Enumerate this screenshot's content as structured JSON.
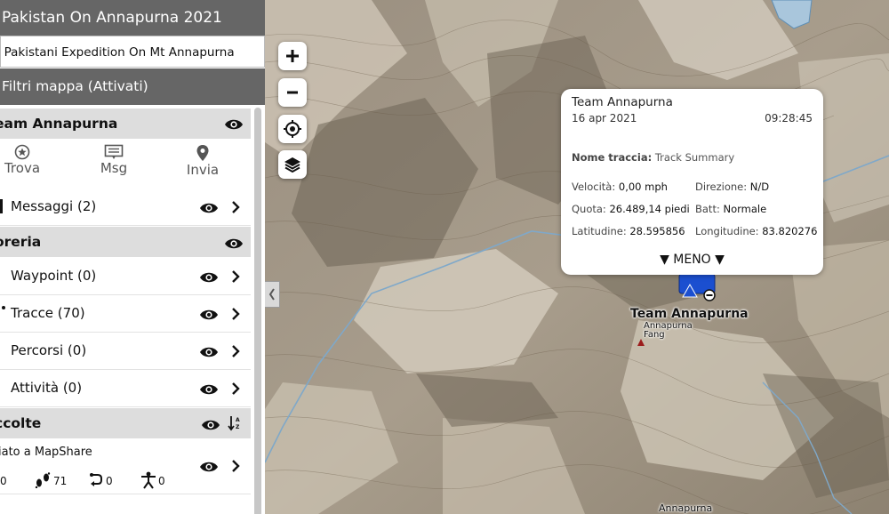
{
  "sidebar": {
    "title": "Pakistan On Annapurna 2021",
    "subtitle": "t Pakistani Expedition On Mt Annapurna",
    "filter_label": "Filtri mappa (Attivati)",
    "team_section": "eam Annapurna",
    "tabs": [
      {
        "label": "Trova",
        "icon": "star-circle-icon"
      },
      {
        "label": "Msg",
        "icon": "message-icon"
      },
      {
        "label": "Invia",
        "icon": "location-pin-icon"
      }
    ],
    "messages_label": "Messaggi (2)",
    "library_section": "oreria",
    "library_items": [
      {
        "label": "Waypoint (0)"
      },
      {
        "label": "Tracce (70)"
      },
      {
        "label": "Percorsi (0)"
      },
      {
        "label": "Attività (0)"
      }
    ],
    "collections_section": "ccolte",
    "collection_item": {
      "label": "iato a MapShare",
      "counts": [
        "0",
        "71",
        "0",
        "0"
      ]
    }
  },
  "map": {
    "controls": [
      "zoom-in",
      "zoom-out",
      "locate",
      "layers"
    ],
    "labels": {
      "team": "Team Annapurna",
      "peak_line1": "Annapurna",
      "peak_line2": "Fang",
      "bottom": "Annapurna"
    }
  },
  "popup": {
    "title": "Team Annapurna",
    "date": "16 apr 2021",
    "time": "09:28:45",
    "track_label": "Nome traccia:",
    "track_value": "Track Summary",
    "speed_label": "Velocità:",
    "speed_value": "0,00 mph",
    "direction_label": "Direzione:",
    "direction_value": "N/D",
    "altitude_label": "Quota:",
    "altitude_value": "26.489,14 piedi",
    "battery_label": "Batt:",
    "battery_value": "Normale",
    "latitude_label": "Latitudine:",
    "latitude_value": "28.595856",
    "longitude_label": "Longitudine:",
    "longitude_value": "83.820276",
    "less_label": "▼ MENO ▼"
  },
  "colors": {
    "header_bg": "#666666",
    "section_bg": "#dddddd",
    "marker_blue": "#1b4fd0",
    "glacier_blue": "#a9c6dc",
    "river_blue": "#7fa8c9"
  }
}
